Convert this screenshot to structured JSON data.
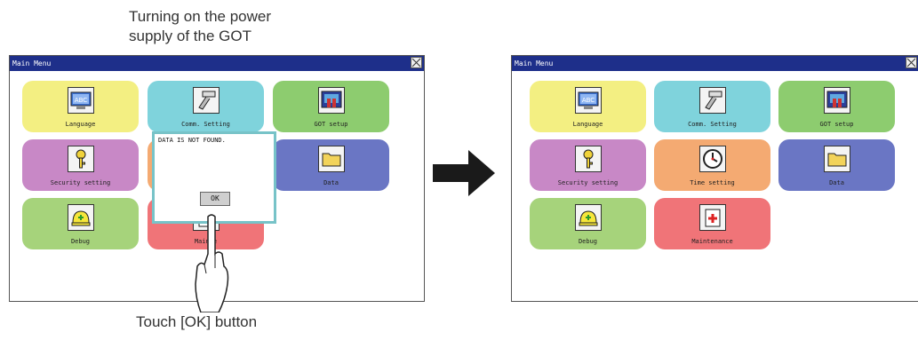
{
  "captions": {
    "top_line1": "Turning on the power",
    "top_line2": "supply of the GOT",
    "bottom": "Touch [OK] button"
  },
  "left_screen": {
    "title": "Main Menu",
    "tiles": [
      {
        "label": "Language",
        "icon": "language-abc-icon",
        "color": "#f3ef82"
      },
      {
        "label": "Comm. Setting",
        "icon": "comm-connector-icon",
        "color": "#7fd3dc"
      },
      {
        "label": "GOT setup",
        "icon": "got-monitor-icon",
        "color": "#8dcc6f"
      },
      {
        "label": "Security setting",
        "icon": "key-icon",
        "color": "#c888c6"
      },
      {
        "label": "Data",
        "icon": "folder-icon",
        "color": "#6a76c4"
      },
      {
        "label": "Debug",
        "icon": "debug-helmet-icon",
        "color": "#a6d37b"
      },
      {
        "label": "Mainte",
        "icon": "maintenance-icon",
        "color": "#f07478"
      }
    ],
    "dialog": {
      "message": "DATA IS NOT FOUND.",
      "ok_label": "OK"
    }
  },
  "right_screen": {
    "title": "Main Menu",
    "tiles": [
      {
        "label": "Language",
        "icon": "language-abc-icon",
        "color": "#f3ef82"
      },
      {
        "label": "Comm. Setting",
        "icon": "comm-connector-icon",
        "color": "#7fd3dc"
      },
      {
        "label": "GOT setup",
        "icon": "got-monitor-icon",
        "color": "#8dcc6f"
      },
      {
        "label": "Security setting",
        "icon": "key-icon",
        "color": "#c888c6"
      },
      {
        "label": "Time setting",
        "icon": "clock-icon",
        "color": "#f4aa72"
      },
      {
        "label": "Data",
        "icon": "folder-icon",
        "color": "#6a76c4"
      },
      {
        "label": "Debug",
        "icon": "debug-helmet-icon",
        "color": "#a6d37b"
      },
      {
        "label": "Maintenance",
        "icon": "maintenance-icon",
        "color": "#f07478"
      }
    ]
  },
  "colors": {
    "titlebar": "#1e2f8a",
    "dialog_border": "#77c3c8"
  }
}
